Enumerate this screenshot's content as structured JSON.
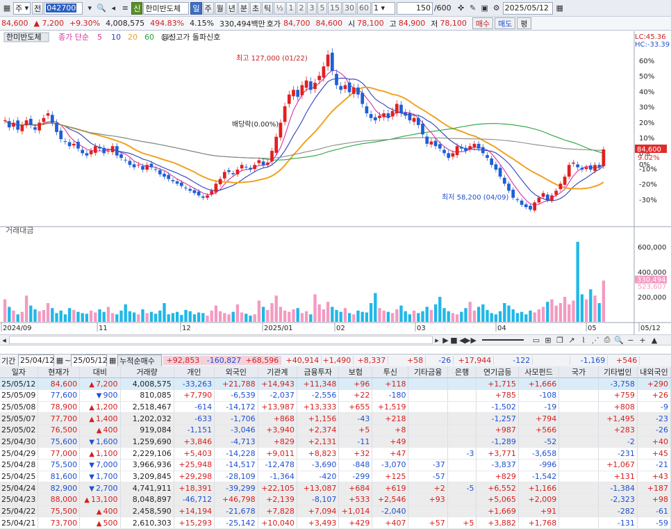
{
  "toolbar": {
    "code_prefix": "주",
    "mode": "전",
    "code": "042700",
    "badge": "신",
    "stock_name": "한미반도체",
    "periods": [
      "일",
      "주",
      "월",
      "년",
      "분",
      "초",
      "틱"
    ],
    "active_period": "일",
    "half": "½",
    "minutes": [
      "1",
      "2",
      "3",
      "5",
      "15",
      "30",
      "60"
    ],
    "unit": "1",
    "count": "150",
    "count_total": "/600",
    "date": "2025/05/12"
  },
  "quote": {
    "price": "84,600",
    "change": "7,200",
    "change_pct": "+9.30%",
    "volume": "4,008,575",
    "vol_ratio": "494.83%",
    "turnover": "4.15%",
    "amount": "330,494백만",
    "ask_label": "호가",
    "ask": "84,700",
    "bid": "84,600",
    "open_label": "시",
    "open": "78,100",
    "high_label": "고",
    "high": "84,900",
    "low_label": "저",
    "low": "78,100",
    "buy": "매수",
    "sell": "매도",
    "avg": "평"
  },
  "chart_data": {
    "type": "candlestick",
    "legend_name": "한미반도체",
    "legend_ma": "종가 단순",
    "ma_periods": [
      "5",
      "10",
      "20",
      "60",
      "120"
    ],
    "ma_colors": [
      "#d4329c",
      "#2a3fb8",
      "#f0a21e",
      "#27a23a",
      "#8a8a8a"
    ],
    "signal": "@신고가 돌파신호",
    "lc_label": "LC:45.36",
    "hc_label": "HC:-33.39",
    "pct_ticks": [
      "60%",
      "50%",
      "40%",
      "30%",
      "20%",
      "10%",
      "0%",
      "-10%",
      "-20%",
      "-30%"
    ],
    "price_ticks": [
      127000,
      115000,
      103000,
      91000,
      79000,
      67000,
      55000,
      43000,
      31000,
      19000
    ],
    "annotation_high": "최고 127,000 (01/22)",
    "annotation_low": "최저 58,200 (04/09)",
    "annotation_div": "배당락(0.00%)",
    "last_price_label": "84,600",
    "last_pct_label": "9.02%",
    "last_zero_label": "0%",
    "volume_title": "거래대금",
    "volume_ticks": [
      "600,000",
      "400,000",
      "200,000"
    ],
    "volume_last": "330,494",
    "volume_ma": "523,607",
    "x_labels": [
      "2024/09",
      "11",
      "12",
      "2025/01",
      "02",
      "03",
      "04",
      "05",
      "05/12"
    ],
    "closes": [
      97000,
      94000,
      96000,
      93000,
      95000,
      97000,
      95000,
      93000,
      96000,
      98000,
      100000,
      96000,
      92000,
      89000,
      88000,
      86000,
      87000,
      85000,
      83000,
      82000,
      84000,
      86000,
      85000,
      83000,
      84000,
      86000,
      82000,
      81000,
      80000,
      78000,
      77000,
      78000,
      76000,
      78000,
      77000,
      76000,
      74000,
      73000,
      72000,
      71000,
      70000,
      69000,
      68000,
      67000,
      66000,
      65000,
      64000,
      65000,
      67000,
      70000,
      72000,
      75000,
      75000,
      74000,
      76000,
      78000,
      77000,
      76000,
      78000,
      80000,
      78000,
      79000,
      84000,
      90000,
      96000,
      103000,
      108000,
      110000,
      107000,
      112000,
      114000,
      110000,
      113000,
      116000,
      120000,
      125000,
      118000,
      112000,
      110000,
      112000,
      109000,
      111000,
      108000,
      104000,
      100000,
      98000,
      97000,
      99000,
      100000,
      98000,
      101000,
      104000,
      100000,
      99000,
      97000,
      98000,
      95000,
      91000,
      87000,
      88000,
      86000,
      85000,
      83000,
      81000,
      83000,
      86000,
      85000,
      84000,
      86000,
      87000,
      85000,
      83000,
      81000,
      78000,
      76000,
      73000,
      70000,
      67000,
      64000,
      63000,
      61000,
      60000,
      59000,
      62000,
      64000,
      66000,
      63000,
      65000,
      67000,
      70000,
      73000,
      78000,
      79000,
      77000,
      76000,
      77000,
      76000,
      78000,
      77000,
      84600
    ],
    "amounts": [
      180,
      120,
      90,
      60,
      80,
      210,
      130,
      100,
      85,
      95,
      150,
      110,
      70,
      90,
      60,
      110,
      95,
      80,
      70,
      65,
      90,
      75,
      100,
      80,
      120,
      70,
      60,
      90,
      140,
      85,
      75,
      60,
      100,
      70,
      80,
      65,
      90,
      150,
      60,
      70,
      80,
      55,
      95,
      85,
      60,
      75,
      70,
      50,
      90,
      130,
      85,
      70,
      60,
      80,
      140,
      75,
      65,
      50,
      60,
      170,
      120,
      95,
      150,
      210,
      120,
      90,
      80,
      100,
      110,
      70,
      85,
      60,
      220,
      140,
      100,
      160,
      120,
      95,
      80,
      110,
      70,
      60,
      90,
      80,
      75,
      150,
      230,
      110,
      90,
      80,
      70,
      100,
      130,
      85,
      60,
      90,
      70,
      85,
      120,
      95,
      140,
      200,
      110,
      85,
      70,
      60,
      80,
      110,
      160,
      90,
      120,
      140,
      95,
      70,
      60,
      85,
      150,
      130,
      100,
      70,
      80,
      60,
      90,
      75,
      100,
      120,
      160,
      180,
      130,
      150,
      200,
      140,
      170,
      640,
      220,
      180,
      260,
      210,
      150,
      330
    ]
  },
  "scroll": {
    "zoom_in": "+",
    "zoom_out": "−",
    "up": "▲"
  },
  "filter": {
    "label": "기간",
    "from": "25/04/12",
    "to": "25/05/12",
    "mode": "누적순매수",
    "sums": [
      "+92,853",
      "-160,827",
      "+68,596",
      "+40,914",
      "+1,490",
      "+8,337",
      "+58",
      "-26",
      "+17,944",
      "-122",
      "",
      "-1,169",
      "+546"
    ]
  },
  "table": {
    "headers": [
      "일자",
      "현재가",
      "대비",
      "거래량",
      "개인",
      "외국인",
      "기관계",
      "금융투자",
      "보험",
      "투신",
      "기타금융",
      "은행",
      "연기금등",
      "사모펀드",
      "국가",
      "기타법인",
      "내외국인"
    ],
    "rows": [
      [
        "25/05/12",
        "84,600",
        "up",
        "7,200",
        "4,008,575",
        "-33,263",
        "+21,788",
        "+14,943",
        "+11,348",
        "+96",
        "+118",
        "",
        "",
        "+1,715",
        "+1,666",
        "",
        "-3,758",
        "+290"
      ],
      [
        "25/05/09",
        "77,600",
        "down",
        "900",
        "810,085",
        "+7,790",
        "-6,539",
        "-2,037",
        "-2,556",
        "+22",
        "-180",
        "",
        "",
        "+785",
        "-108",
        "",
        "+759",
        "+26"
      ],
      [
        "25/05/08",
        "78,900",
        "up",
        "1,200",
        "2,518,467",
        "-614",
        "-14,172",
        "+13,987",
        "+13,333",
        "+655",
        "+1,519",
        "",
        "",
        "-1,502",
        "-19",
        "",
        "+808",
        "-9"
      ],
      [
        "25/05/07",
        "77,700",
        "up",
        "1,400",
        "1,202,032",
        "-633",
        "-1,706",
        "+868",
        "+1,156",
        "-43",
        "+218",
        "",
        "",
        "-1,257",
        "+794",
        "",
        "+1,495",
        "-23"
      ],
      [
        "25/05/02",
        "76,500",
        "up",
        "400",
        "919,084",
        "-1,151",
        "-3,046",
        "+3,940",
        "+2,374",
        "+5",
        "+8",
        "",
        "",
        "+987",
        "+566",
        "",
        "+283",
        "-26"
      ],
      [
        "25/04/30",
        "75,600",
        "down",
        "1,600",
        "1,259,690",
        "+3,846",
        "-4,713",
        "+829",
        "+2,131",
        "-11",
        "+49",
        "",
        "",
        "-1,289",
        "-52",
        "",
        "-2",
        "+40"
      ],
      [
        "25/04/29",
        "77,000",
        "up",
        "1,100",
        "2,229,106",
        "+5,403",
        "-14,228",
        "+9,011",
        "+8,823",
        "+32",
        "+47",
        "",
        "-3",
        "+3,771",
        "-3,658",
        "",
        "-231",
        "+45"
      ],
      [
        "25/04/28",
        "75,500",
        "down",
        "7,000",
        "3,966,936",
        "+25,948",
        "-14,517",
        "-12,478",
        "-3,690",
        "-848",
        "-3,070",
        "-37",
        "",
        "-3,837",
        "-996",
        "",
        "+1,067",
        "-21"
      ],
      [
        "25/04/25",
        "81,600",
        "down",
        "1,700",
        "3,209,845",
        "+29,298",
        "-28,109",
        "-1,364",
        "-420",
        "-299",
        "+125",
        "-57",
        "",
        "+829",
        "-1,542",
        "",
        "+131",
        "+43"
      ],
      [
        "25/04/24",
        "82,900",
        "down",
        "2,700",
        "4,741,911",
        "+18,391",
        "-39,299",
        "+22,105",
        "+13,087",
        "+684",
        "+619",
        "+2",
        "-5",
        "+6,552",
        "+1,166",
        "",
        "-1,384",
        "+187"
      ],
      [
        "25/04/23",
        "88,000",
        "up",
        "13,100",
        "8,048,897",
        "-46,712",
        "+46,798",
        "+2,139",
        "-8,107",
        "+533",
        "+2,546",
        "+93",
        "",
        "+5,065",
        "+2,009",
        "",
        "-2,323",
        "+98"
      ],
      [
        "25/04/22",
        "75,500",
        "up",
        "400",
        "2,458,590",
        "+14,194",
        "-21,678",
        "+7,828",
        "+7,094",
        "+1,014",
        "-2,040",
        "",
        "",
        "+1,669",
        "+91",
        "",
        "-282",
        "-61"
      ],
      [
        "25/04/21",
        "73,700",
        "up",
        "500",
        "2,610,303",
        "+15,293",
        "-25,142",
        "+10,040",
        "+3,493",
        "+429",
        "+407",
        "+57",
        "+5",
        "+3,882",
        "+1,768",
        "",
        "-131",
        "-59"
      ]
    ]
  }
}
